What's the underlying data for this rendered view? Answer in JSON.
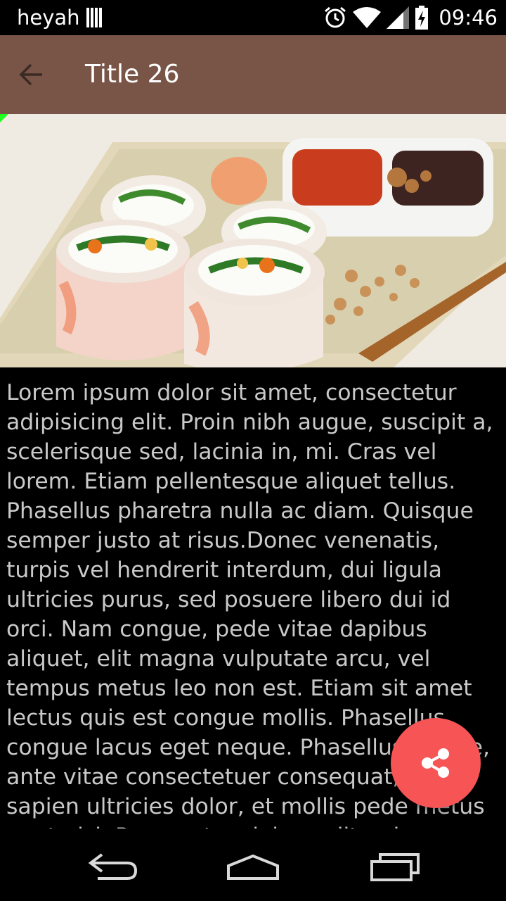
{
  "status_bar": {
    "carrier": "heyah",
    "time": "09:46",
    "icons": [
      "sim-signal-icon",
      "alarm-icon",
      "wifi-icon",
      "cell-signal-icon",
      "battery-charging-icon"
    ]
  },
  "toolbar": {
    "title": "Title 26",
    "back_icon": "arrow-back-icon",
    "background": "#795548"
  },
  "hero": {
    "subject": "sushi-rolls-photo"
  },
  "article": {
    "body": "Lorem ipsum dolor sit amet, consectetur adipisicing elit. Proin nibh augue, suscipit a, scelerisque sed, lacinia in, mi. Cras vel lorem. Etiam pellentesque aliquet tellus. Phasellus pharetra nulla ac diam. Quisque semper justo at risus.Donec venenatis, turpis vel hendrerit interdum, dui ligula ultricies purus, sed posuere libero dui id orci. Nam congue, pede vitae dapibus aliquet, elit magna vulputate arcu, vel tempus metus leo non est. Etiam sit amet lectus quis est congue mollis. Phasellus congue lacus eget neque. Phasellus ornare, ante vitae consectetuer consequat, purus sapien ultricies dolor, et mollis pede metus eget nisi. Praesent sodales velit quis augue."
  },
  "fab": {
    "icon": "share-icon",
    "color": "#f75456"
  },
  "nav_bar": {
    "icons": [
      "back-icon",
      "home-icon",
      "recent-apps-icon"
    ]
  }
}
